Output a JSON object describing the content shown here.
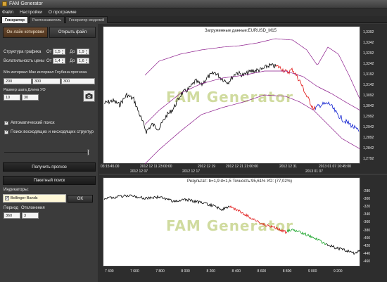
{
  "window": {
    "title": "FAM Generator"
  },
  "menu": [
    "Файл",
    "Настройки",
    "О программе"
  ],
  "tabs": [
    "Генератор",
    "Распознаватель",
    "Генератор моделей"
  ],
  "left": {
    "online_button": "Он-лайн котировки",
    "open_file_button": "Открыть файл",
    "structure_label": "Структура графика",
    "volatility_label": "Волатильность цены",
    "from_label": "От",
    "to_label": "До",
    "structure_from": "1,5",
    "structure_to": "1,9",
    "volatility_from": "1,4",
    "volatility_to": "1,6",
    "intervals_header": "Min интервал Max интервал Глубина прогноза",
    "min_interval": "200",
    "max_interval": "300",
    "forecast_depth": "300",
    "wave_size_label": "Размер шага Длина УО",
    "step_size": "10",
    "wave_length": "30",
    "auto_search_label": "Автоматический поиск",
    "auto_search_checked": true,
    "structure_search_label": "Поиск восходящих и нисходящих структур",
    "structure_search_checked": true,
    "get_forecast_button": "Получить прогноз",
    "batch_search_button": "Пакетный поиск",
    "indicators_label": "Индикаторы:",
    "indicator_item": "Bollinger Bands",
    "ok_button": "OK",
    "period_label": "Период",
    "deviation_label": "Отклонения",
    "period_value": "360",
    "deviation_value": "3"
  },
  "top_chart": {
    "title": "Загруженные данные:EURUSD_M15",
    "y_ticks": [
      "1,3392",
      "1,3342",
      "1,3292",
      "1,3242",
      "1,3192",
      "1,3142",
      "1,3092",
      "1,3042",
      "1,2992",
      "1,2942",
      "1,2892",
      "1,2842",
      "1,2792"
    ],
    "x_ticks_row1": [
      "03:15:45.00",
      "2012 12 11 23:00:00",
      "2012 12 19",
      "2012 12 21 21:00:00",
      "2012 12 31",
      "2013 01 07 16:45:00"
    ],
    "x_ticks_row2": [
      "2012 12 07",
      "2012 12 17",
      "2013 01 07"
    ],
    "watermark": "FAM Generator"
  },
  "bottom_chart": {
    "title": "Результат: b=1,9 d=1,5  Точность:95,61%  УО: (77,02%)",
    "y_ticks": [
      "-280",
      "-300",
      "-320",
      "-340",
      "-360",
      "-380",
      "-400",
      "-420",
      "-440",
      "-460"
    ],
    "x_ticks": [
      "7 400",
      "7 600",
      "7 800",
      "8 000",
      "8 200",
      "8 400",
      "8 600",
      "8 800",
      "9 000",
      "9 200"
    ],
    "watermark": "FAM Generator"
  },
  "colors": {
    "price_line": "#000000",
    "bands": "#8b1a8b",
    "forecast_red": "#e01010",
    "forecast_blue": "#1020d0",
    "forecast_green": "#10a020",
    "online_button_bg": "#5a3d25"
  }
}
